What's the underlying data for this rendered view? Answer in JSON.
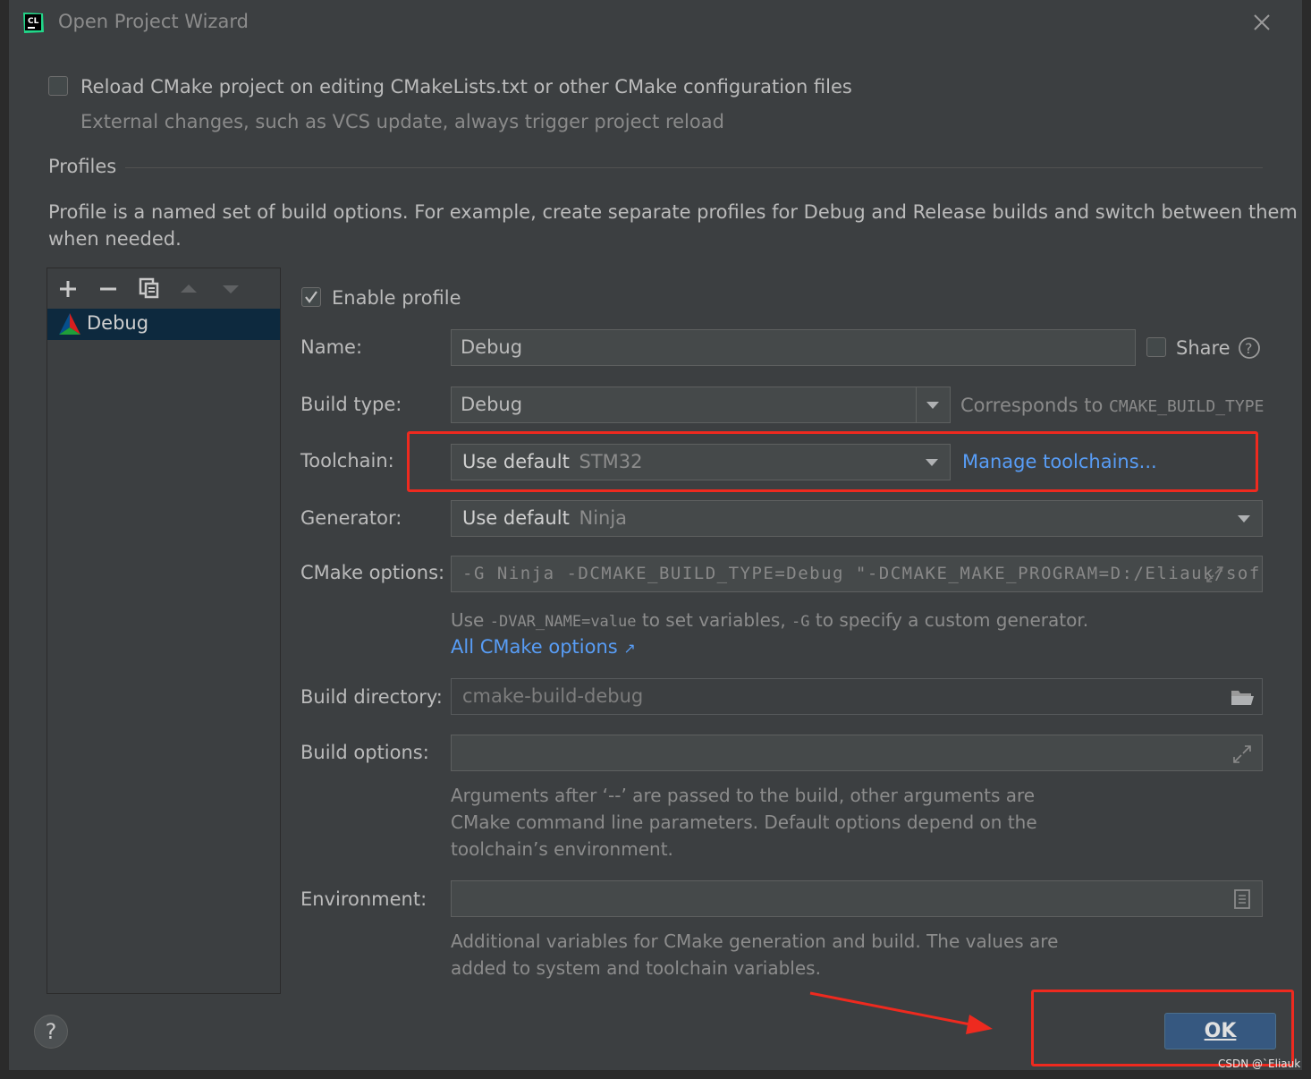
{
  "window": {
    "title": "Open Project Wizard",
    "app_logo": "CL"
  },
  "reload": {
    "label": "Reload CMake project on editing CMakeLists.txt or other CMake configuration files",
    "hint": "External changes, such as VCS update, always trigger project reload",
    "checked": false
  },
  "profiles": {
    "section_title": "Profiles",
    "description_line1": "Profile is a named set of build options. For example, create separate profiles for Debug and Release builds and switch between them",
    "description_line2": "when needed.",
    "toolbar": [
      "plus-icon",
      "minus-icon",
      "copy-icon",
      "move-up-icon",
      "move-down-icon"
    ],
    "items": [
      {
        "label": "Debug",
        "selected": true
      }
    ]
  },
  "form": {
    "enable_profile": {
      "label": "Enable profile",
      "checked": true
    },
    "name": {
      "label": "Name:",
      "value": "Debug"
    },
    "share": {
      "label": "Share",
      "checked": false
    },
    "build_type": {
      "label": "Build type:",
      "value": "Debug",
      "note": "Corresponds to",
      "note_code": "CMAKE_BUILD_TYPE"
    },
    "toolchain": {
      "label": "Toolchain:",
      "value": "Use default",
      "value_hint": "STM32",
      "manage_link": "Manage toolchains..."
    },
    "generator": {
      "label": "Generator:",
      "value": "Use default",
      "value_hint": "Ninja"
    },
    "cmake_options": {
      "label": "CMake options:",
      "value": "-G Ninja -DCMAKE_BUILD_TYPE=Debug \"-DCMAKE_MAKE_PROGRAM=D:/Eliauk/sof",
      "hint_use": "Use",
      "hint_code1": "-DVAR_NAME=value",
      "hint_mid": "to set variables,",
      "hint_code2": "-G",
      "hint_end": "to specify a custom generator.",
      "link": "All CMake options"
    },
    "build_directory": {
      "label": "Build directory:",
      "value": "cmake-build-debug"
    },
    "build_options": {
      "label": "Build options:",
      "value": "",
      "hint_line1": "Arguments after ‘--’ are passed to the build, other arguments are",
      "hint_line2": "CMake command line parameters. Default options depend on the",
      "hint_line3": "toolchain’s environment."
    },
    "environment": {
      "label": "Environment:",
      "value": "",
      "hint_line1": "Additional variables for CMake generation and build. The values are",
      "hint_line2": "added to system and toolchain variables."
    }
  },
  "footer": {
    "help_label": "?",
    "ok_label": "OK"
  },
  "watermark": "CSDN @`Eliauk",
  "colors": {
    "background": "#3c3f41",
    "selection": "#0d293e",
    "link": "#589df6",
    "ok_button": "#365880",
    "annotation": "#ee2a1f"
  }
}
